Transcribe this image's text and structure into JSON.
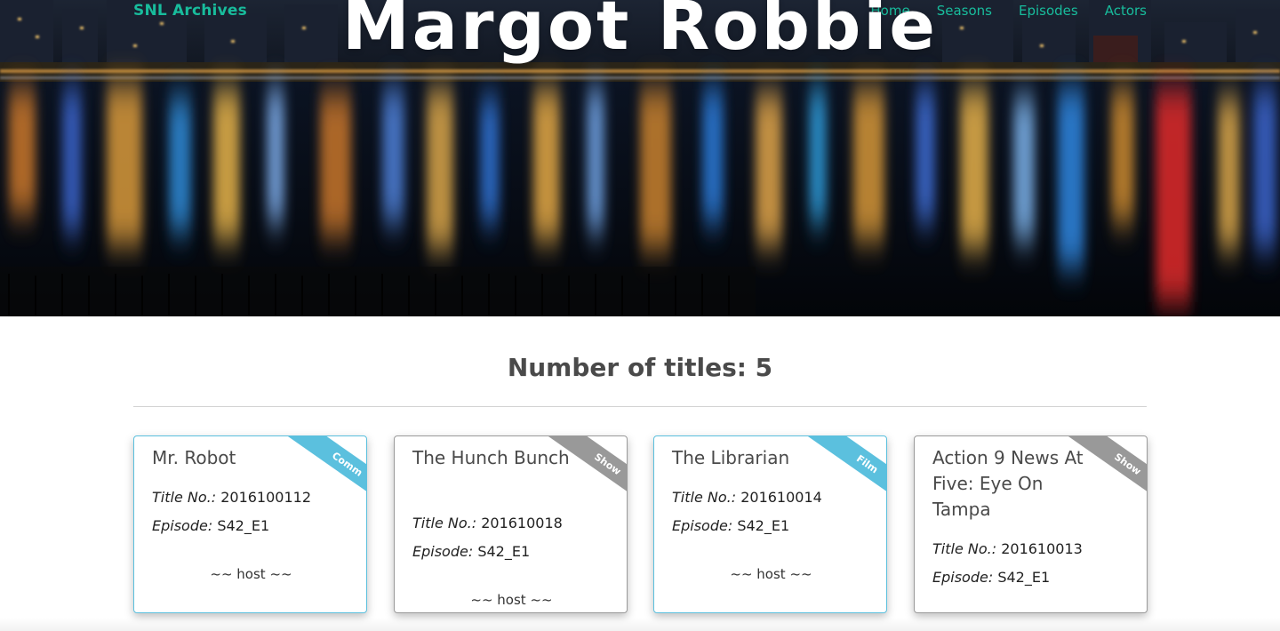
{
  "nav": {
    "brand": "SNL Archives",
    "links": [
      "Home",
      "Seasons",
      "Episodes",
      "Actors"
    ]
  },
  "hero": {
    "title": "Margot Robbie"
  },
  "main": {
    "count_heading": "Number of titles: 5"
  },
  "cards": [
    {
      "title": "Mr. Robot",
      "title_no_label": "Title No.:",
      "title_no": "2016100112",
      "episode_label": "Episode:",
      "episode": "S42_E1",
      "host": "~~ host ~~",
      "ribbon": "Comm",
      "ribbon_color": "#5bc0de"
    },
    {
      "title": "The Hunch Bunch",
      "title_no_label": "Title No.:",
      "title_no": "201610018",
      "episode_label": "Episode:",
      "episode": "S42_E1",
      "host": "~~ host ~~",
      "ribbon": "Show",
      "ribbon_color": "#999999"
    },
    {
      "title": "The Librarian",
      "title_no_label": "Title No.:",
      "title_no": "201610014",
      "episode_label": "Episode:",
      "episode": "S42_E1",
      "host": "~~ host ~~",
      "ribbon": "Film",
      "ribbon_color": "#5bc0de"
    },
    {
      "title": "Action 9 News At Five: Eye On Tampa",
      "title_no_label": "Title No.:",
      "title_no": "201610013",
      "episode_label": "Episode:",
      "episode": "S42_E1",
      "host": "",
      "ribbon": "Show",
      "ribbon_color": "#999999"
    }
  ],
  "colors": {
    "accent": "#18bc9c",
    "ribbon_blue": "#5bc0de",
    "ribbon_gray": "#999999",
    "heading": "#4a4a4a"
  }
}
